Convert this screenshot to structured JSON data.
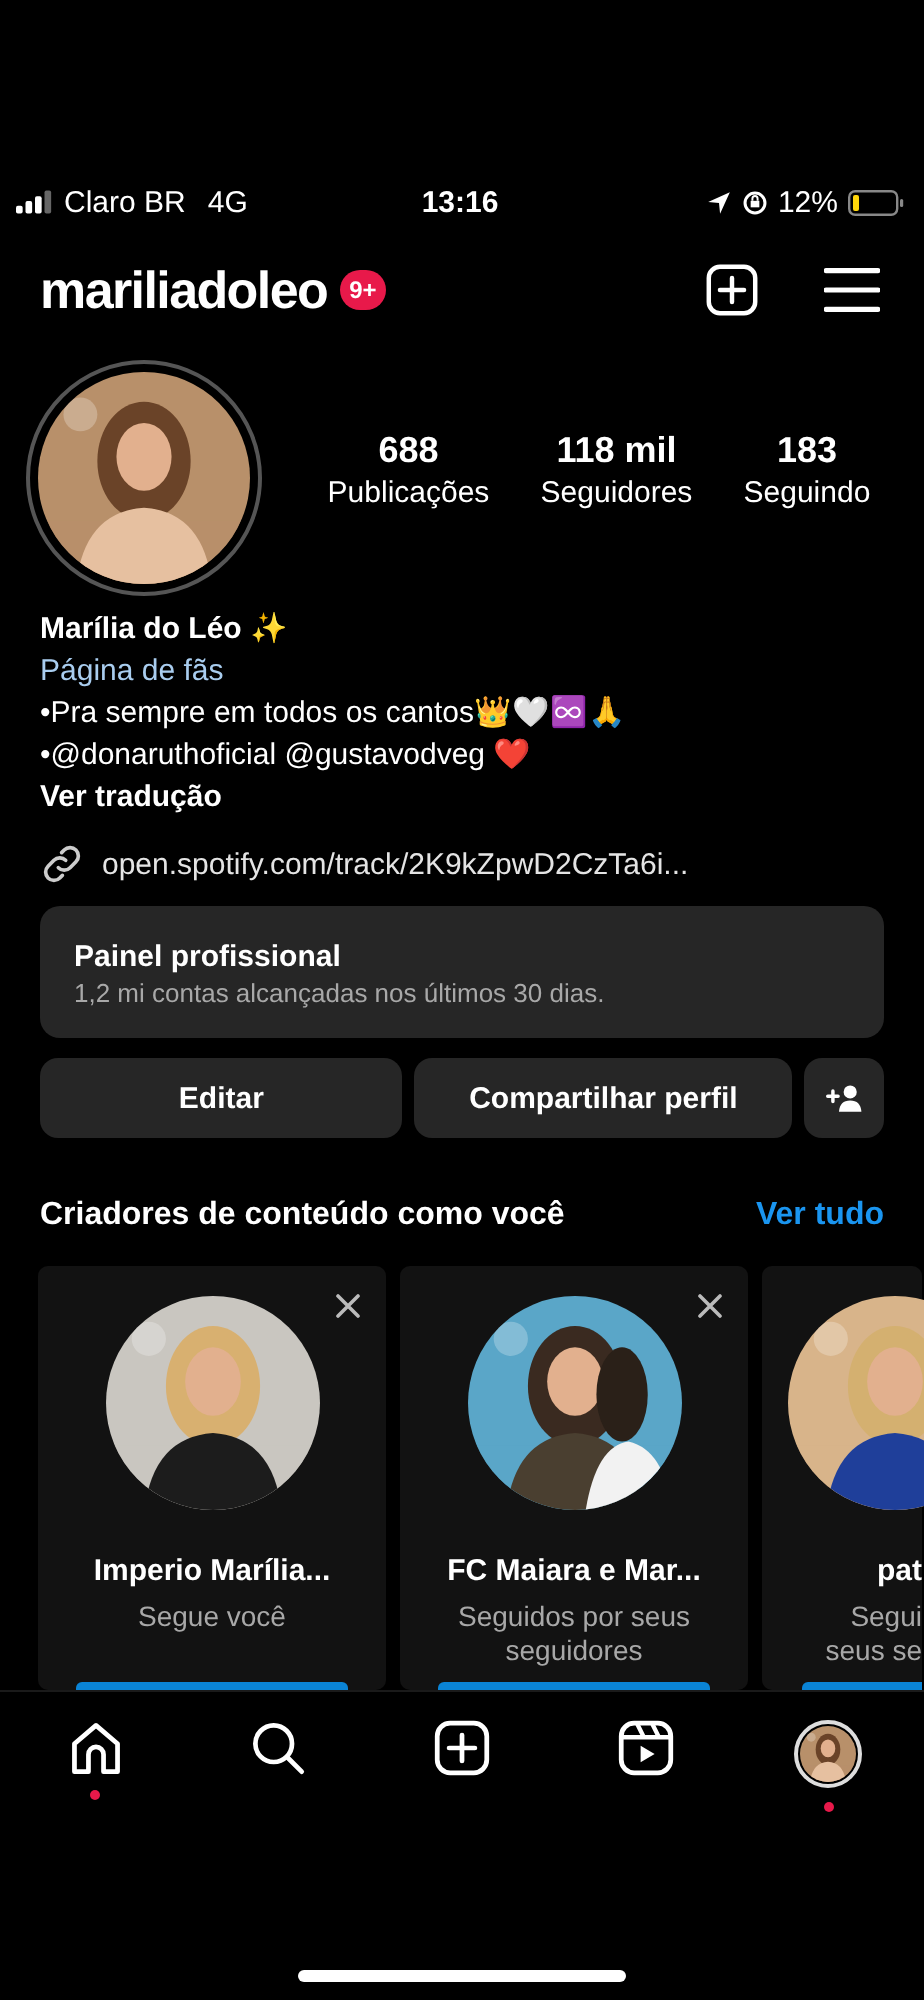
{
  "status_bar": {
    "carrier": "Claro BR",
    "network": "4G",
    "time": "13:16",
    "battery": "12%"
  },
  "header": {
    "username": "mariliadoleo",
    "badge": "9+"
  },
  "stats": [
    {
      "value": "688",
      "label": "Publicações"
    },
    {
      "value": "118 mil",
      "label": "Seguidores"
    },
    {
      "value": "183",
      "label": "Seguindo"
    }
  ],
  "bio": {
    "name": "Marília do Léo ✨",
    "category": "Página de fãs",
    "lines": [
      "•Pra sempre em todos os cantos👑🤍♾️🙏",
      "•@donaruthoficial @gustavodveg ❤️"
    ],
    "translate": "Ver tradução",
    "link": "open.spotify.com/track/2K9kZpwD2CzTa6i..."
  },
  "dashboard": {
    "title": "Painel profissional",
    "subtitle": "1,2 mi contas alcançadas nos últimos 30 dias."
  },
  "buttons": [
    "Editar",
    "Compartilhar perfil"
  ],
  "suggestions": {
    "title": "Criadores de conteúdo como você",
    "see_all": "Ver tudo",
    "cards": [
      {
        "kind": "full",
        "name": "Imperio Marília...",
        "note": "Segue você"
      },
      {
        "kind": "full",
        "name": "FC Maiara e Mar...",
        "note": "Seguidos por seus seguidores"
      },
      {
        "kind": "partial",
        "name": "pat",
        "note": "Segui",
        "note2": "seus se"
      }
    ]
  },
  "tab_bar": [
    {
      "kind": "home",
      "selected": false,
      "notification": true
    },
    {
      "kind": "search",
      "selected": false,
      "notification": false
    },
    {
      "kind": "create",
      "selected": false,
      "notification": false
    },
    {
      "kind": "reels",
      "selected": false,
      "notification": false
    },
    {
      "kind": "profile",
      "selected": true,
      "notification": true
    }
  ]
}
